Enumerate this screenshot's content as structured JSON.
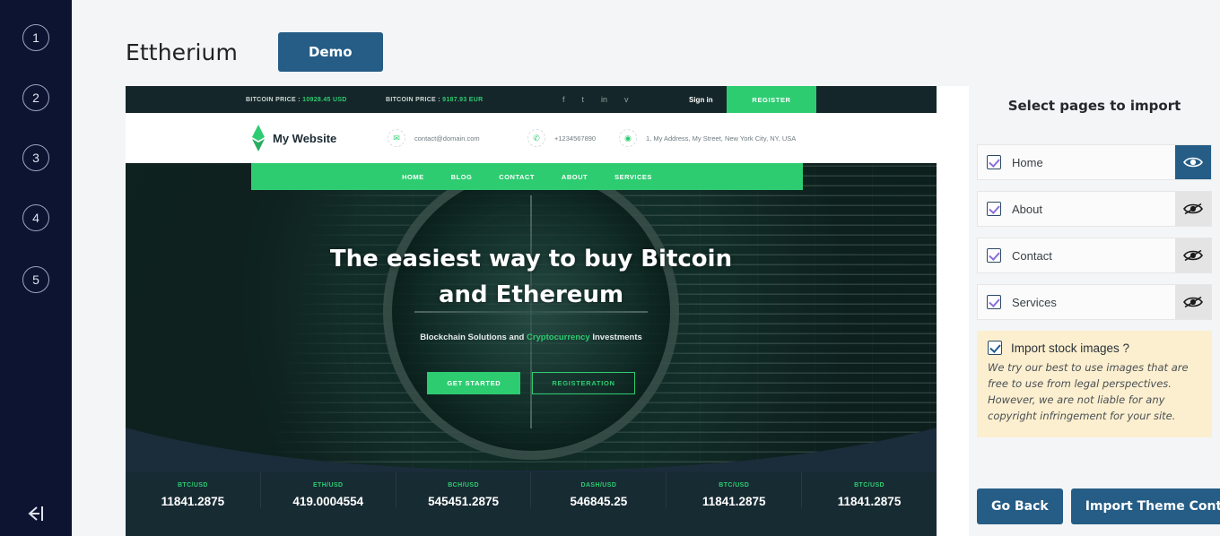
{
  "rail": {
    "steps": [
      "1",
      "2",
      "3",
      "4",
      "5"
    ],
    "exit_icon": "exit-arrow-icon"
  },
  "header": {
    "theme_title": "Ettherium",
    "demo_label": "Demo"
  },
  "preview": {
    "ticker": {
      "price_label_1": "BITCOIN PRICE : ",
      "price_value_1": "10928.45 USD",
      "price_label_2": "BITCOIN PRICE : ",
      "price_value_2": "9187.93 EUR",
      "social": [
        "f",
        "t",
        "in",
        "v"
      ],
      "sign_in": "Sign in",
      "register": "REGISTER"
    },
    "site_header": {
      "brand": "My Website",
      "email": "contact@domain.com",
      "phone": "+1234567890",
      "address": "1, My Address, My Street, New York City, NY, USA"
    },
    "nav": [
      "HOME",
      "BLOG",
      "CONTACT",
      "ABOUT",
      "SERVICES"
    ],
    "hero": {
      "line1": "The easiest way to buy Bitcoin",
      "line2": "and Ethereum",
      "sub_a": "Blockchain Solutions and ",
      "sub_b": "Cryptocurrency",
      "sub_c": " Investments",
      "cta_primary": "GET STARTED",
      "cta_secondary": "REGISTERATION"
    },
    "rates": [
      {
        "pair": "BTC/USD",
        "value": "11841.2875"
      },
      {
        "pair": "ETH/USD",
        "value": "419.0004554"
      },
      {
        "pair": "BCH/USD",
        "value": "545451.2875"
      },
      {
        "pair": "DASH/USD",
        "value": "546845.25"
      },
      {
        "pair": "BTC/USD",
        "value": "11841.2875"
      },
      {
        "pair": "BTC/USD",
        "value": "11841.2875"
      }
    ]
  },
  "panel": {
    "title": "Select pages to import",
    "pages": [
      {
        "label": "Home",
        "checked": true,
        "preview_active": true
      },
      {
        "label": "About",
        "checked": true,
        "preview_active": false
      },
      {
        "label": "Contact",
        "checked": true,
        "preview_active": false
      },
      {
        "label": "Services",
        "checked": true,
        "preview_active": false
      }
    ],
    "notice": {
      "title": "Import stock images ?",
      "body": "We try our best to use images that are free to use from legal perspectives. However, we are not liable for any copyright infringement for your site."
    },
    "go_back": "Go Back",
    "import": "Import Theme Content"
  },
  "colors": {
    "accent_blue": "#255d86",
    "rail_navy": "#0d1431",
    "green": "#2ecc71",
    "notice_bg": "#fcefcf"
  }
}
